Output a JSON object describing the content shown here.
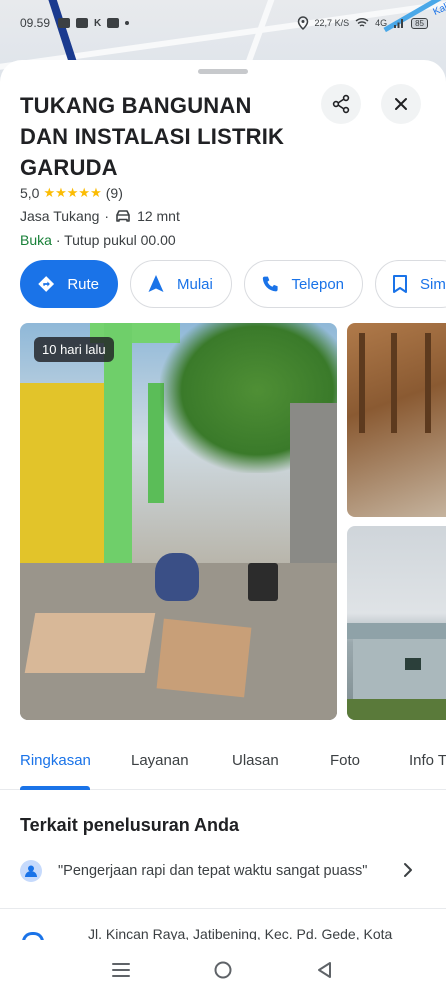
{
  "status_bar": {
    "time": "09.59",
    "network": "22,7 K/S",
    "signal": "4G",
    "battery": "85"
  },
  "map": {
    "label": "Kali"
  },
  "place": {
    "name": "TUKANG BANGUNAN DAN INSTALASI LISTRIK GARUDA",
    "rating": "5,0",
    "stars": "★★★★★",
    "review_count": "(9)",
    "category": "Jasa Tukang",
    "separator": "·",
    "drive_time": "12 mnt",
    "open_status": "Buka",
    "hours_detail": "· Tutup pukul 00.00"
  },
  "actions": [
    {
      "label": "Rute",
      "icon": "directions-icon"
    },
    {
      "label": "Mulai",
      "icon": "navigation-arrow-icon"
    },
    {
      "label": "Telepon",
      "icon": "phone-icon"
    },
    {
      "label": "Sim",
      "icon": "bookmark-icon"
    }
  ],
  "photos": {
    "badge": "10 hari lalu"
  },
  "tabs": [
    "Ringkasan",
    "Layanan",
    "Ulasan",
    "Foto",
    "Info T"
  ],
  "related": {
    "title": "Terkait penelusuran Anda",
    "quote": "\"Pengerjaan rapi dan tepat waktu sangat puass\""
  },
  "address": "Jl. Kincan Raya, Jatibening, Kec. Pd. Gede, Kota",
  "colors": {
    "accent": "#1a73e8",
    "open": "#188038",
    "star": "#fbbc04"
  }
}
